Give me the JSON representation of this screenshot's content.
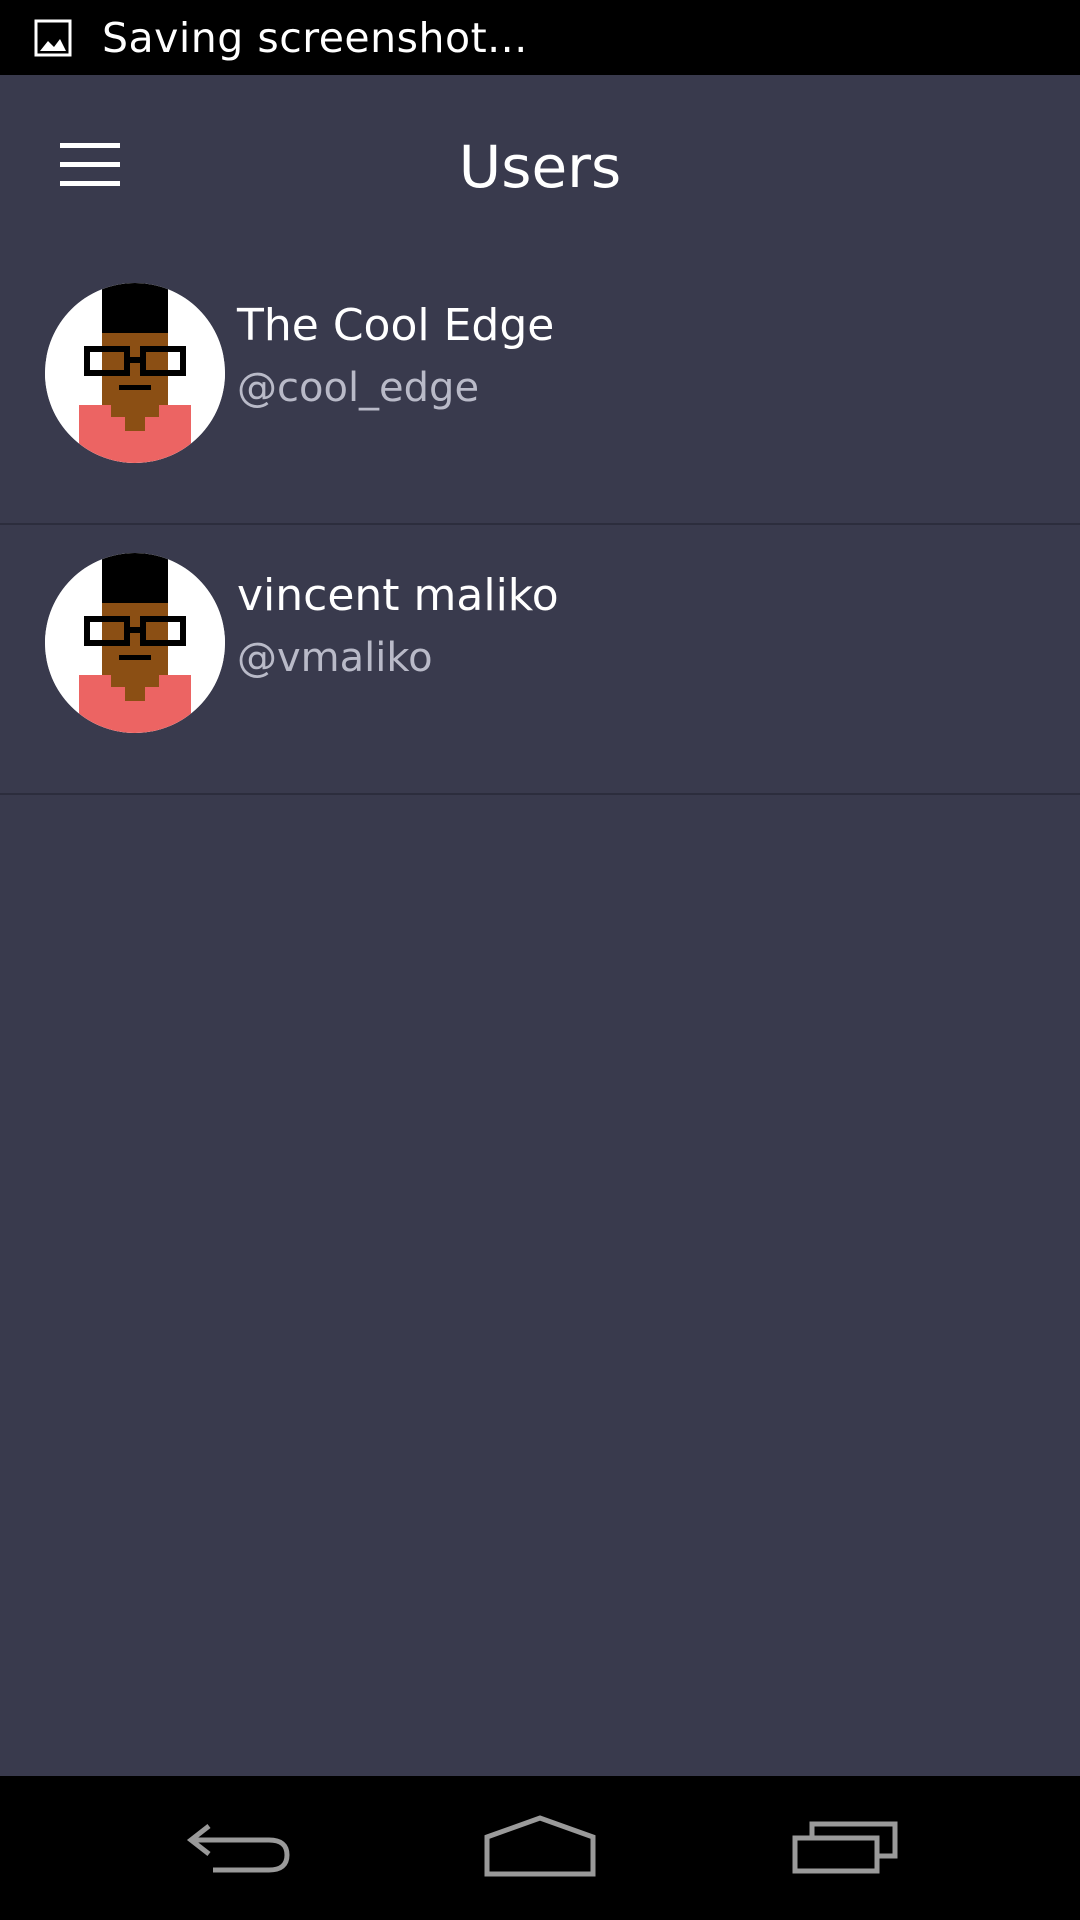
{
  "status_bar": {
    "notification_icon": "image-icon",
    "notification_text": "Saving screenshot..."
  },
  "app_bar": {
    "menu_icon": "hamburger-menu-icon",
    "title": "Users"
  },
  "users": [
    {
      "name": "The Cool Edge",
      "handle": "@cool_edge",
      "avatar": "pixel-avatar"
    },
    {
      "name": "vincent maliko",
      "handle": "@vmaliko",
      "avatar": "pixel-avatar"
    }
  ],
  "nav_bar": {
    "back_icon": "back-icon",
    "home_icon": "home-icon",
    "recents_icon": "recent-apps-icon"
  },
  "colors": {
    "background": "#393a4d",
    "bars": "#000000",
    "title_text": "#ffffff",
    "handle_text": "#b9bac8",
    "avatar_skin": "#8b4f14",
    "avatar_shirt": "#ec6463",
    "avatar_hair": "#000000"
  }
}
